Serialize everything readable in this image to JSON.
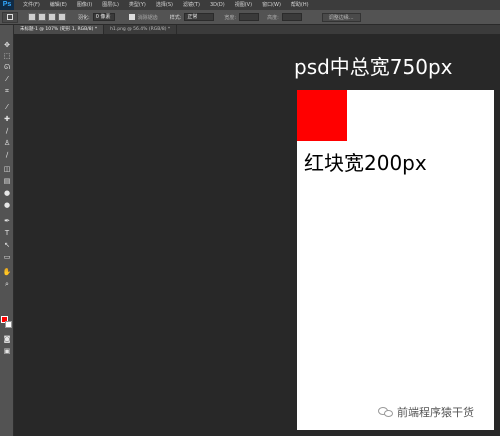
{
  "app": {
    "logo": "Ps"
  },
  "menu": [
    "文件(F)",
    "编辑(E)",
    "图像(I)",
    "图层(L)",
    "类型(Y)",
    "选择(S)",
    "滤镜(T)",
    "3D(D)",
    "视图(V)",
    "窗口(W)",
    "帮助(H)"
  ],
  "options_bar": {
    "feather_label": "羽化:",
    "feather_value": "0 像素",
    "antialias_label": "消除锯齿",
    "style_label": "样式:",
    "style_value": "正常",
    "width_label": "宽度:",
    "height_label": "高度:",
    "refine_edge": "调整边缘..."
  },
  "tabs": [
    {
      "label": "未标题-1 @ 107% (矩形 1, RGB/8) *",
      "active": true
    },
    {
      "label": "h1.png @ 56.4% (RGB/8) *",
      "active": false
    }
  ],
  "tools": [
    "move-tool-icon",
    "marquee-tool-icon",
    "lasso-tool-icon",
    "quick-select-tool-icon",
    "crop-tool-icon",
    "eyedropper-tool-icon",
    "healing-brush-tool-icon",
    "brush-tool-icon",
    "clone-stamp-tool-icon",
    "history-brush-tool-icon",
    "eraser-tool-icon",
    "gradient-tool-icon",
    "blur-tool-icon",
    "dodge-tool-icon",
    "pen-tool-icon",
    "type-tool-icon",
    "path-select-tool-icon",
    "shape-tool-icon",
    "hand-tool-icon",
    "zoom-tool-icon"
  ],
  "colors": {
    "foreground": "#ff0000",
    "background": "#ffffff"
  },
  "canvas": {
    "title_text": "psd中总宽750px",
    "block_text": "红块宽200px"
  },
  "watermark": {
    "text": "前端程序猿干货"
  }
}
